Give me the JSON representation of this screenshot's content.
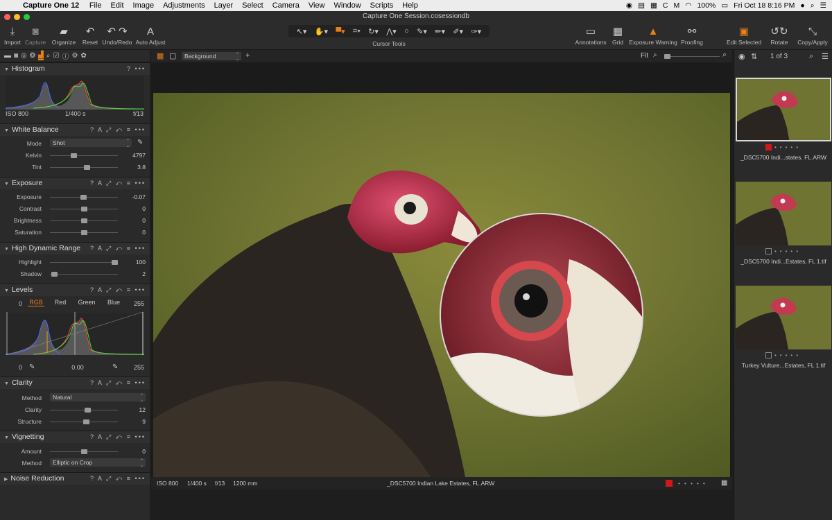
{
  "menubar": {
    "app": "Capture One 12",
    "items": [
      "File",
      "Edit",
      "Image",
      "Adjustments",
      "Layer",
      "Select",
      "Camera",
      "View",
      "Window",
      "Scripts",
      "Help"
    ],
    "battery": "100%",
    "datetime": "Fri Oct 18  8:16 PM"
  },
  "window": {
    "title": "Capture One Session.cosessiondb"
  },
  "toolbar": {
    "import": "Import",
    "capture": "Capture",
    "organize": "Organize",
    "reset": "Reset",
    "undo_redo": "Undo/Redo",
    "auto_adjust": "Auto Adjust",
    "cursor_tools": "Cursor Tools",
    "annotations": "Annotations",
    "grid": "Grid",
    "exposure_warning": "Exposure Warning",
    "proofing": "Proofing",
    "edit_selected": "Edit Selected",
    "rotate": "Rotate",
    "copy_apply": "Copy/Apply"
  },
  "viewbar": {
    "layer": "Background",
    "fit": "Fit"
  },
  "browser": {
    "count": "1 of 3"
  },
  "histogram": {
    "title": "Histogram",
    "iso": "ISO 800",
    "shutter": "1/400 s",
    "aperture": "f/13"
  },
  "white_balance": {
    "title": "White Balance",
    "mode_label": "Mode",
    "mode": "Shot",
    "kelvin_label": "Kelvin",
    "kelvin": "4797",
    "kelvin_pos": 0.34,
    "tint_label": "Tint",
    "tint": "3.8",
    "tint_pos": 0.55
  },
  "exposure": {
    "title": "Exposure",
    "rows": [
      {
        "label": "Exposure",
        "value": "-0.07",
        "pos": 0.49
      },
      {
        "label": "Contrast",
        "value": "0",
        "pos": 0.5
      },
      {
        "label": "Brightness",
        "value": "0",
        "pos": 0.5
      },
      {
        "label": "Saturation",
        "value": "0",
        "pos": 0.5
      }
    ]
  },
  "hdr": {
    "title": "High Dynamic Range",
    "rows": [
      {
        "label": "Highlight",
        "value": "100",
        "pos": 1.0
      },
      {
        "label": "Shadow",
        "value": "2",
        "pos": 0.02
      }
    ]
  },
  "levels": {
    "title": "Levels",
    "low": "0",
    "high": "255",
    "tabs": [
      "RGB",
      "Red",
      "Green",
      "Blue"
    ],
    "out_low": "0",
    "gamma": "0.00",
    "out_high": "255"
  },
  "clarity": {
    "title": "Clarity",
    "method_label": "Method",
    "method": "Natural",
    "rows": [
      {
        "label": "Clarity",
        "value": "12",
        "pos": 0.56
      },
      {
        "label": "Structure",
        "value": "9",
        "pos": 0.54
      }
    ]
  },
  "vignetting": {
    "title": "Vignetting",
    "amount_label": "Amount",
    "amount": "0",
    "amount_pos": 0.5,
    "method_label": "Method",
    "method": "Elliptic on Crop"
  },
  "noise": {
    "title": "Noise Reduction"
  },
  "panel_tools": "? A ⤢ ↶ ≡ •••",
  "viewer_info": {
    "iso": "ISO 800",
    "shutter": "1/400 s",
    "aperture": "f/13",
    "focal": "1200 mm",
    "filename": "_DSC5700 Indian Lake Estates, FL.ARW"
  },
  "thumbnails": [
    {
      "caption": "_DSC5700 Indi...states, FL.ARW",
      "color_tag": "#d01818"
    },
    {
      "caption": "_DSC5700 Indi...Estates, FL 1.tif",
      "color_tag": ""
    },
    {
      "caption": "Turkey Vulture...Estates, FL 1.tif",
      "color_tag": ""
    }
  ],
  "colors": {
    "accent": "#e8801a",
    "tag_red": "#d01818"
  }
}
